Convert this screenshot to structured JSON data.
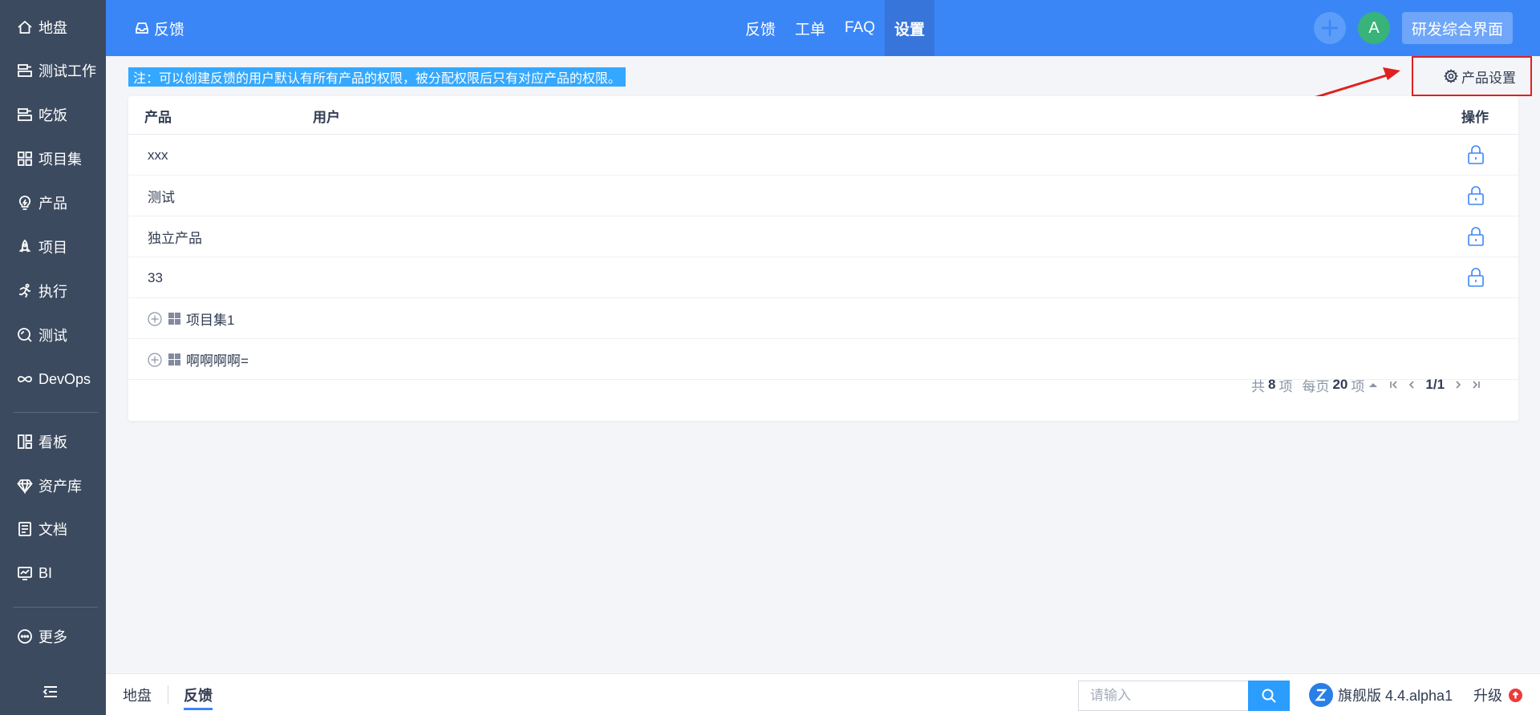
{
  "sidebar": {
    "items": [
      {
        "label": "地盘",
        "icon": "home-icon"
      },
      {
        "label": "测试工作",
        "icon": "workspace-icon"
      },
      {
        "label": "吃饭",
        "icon": "workspace-icon"
      },
      {
        "label": "项目集",
        "icon": "grid-icon"
      },
      {
        "label": "产品",
        "icon": "lightbulb-icon"
      },
      {
        "label": "项目",
        "icon": "rocket-icon"
      },
      {
        "label": "执行",
        "icon": "run-icon"
      },
      {
        "label": "测试",
        "icon": "magnify-icon"
      },
      {
        "label": "DevOps",
        "icon": "infinity-icon"
      },
      {
        "label": "看板",
        "icon": "kanban-icon"
      },
      {
        "label": "资产库",
        "icon": "diamond-icon"
      },
      {
        "label": "文档",
        "icon": "document-icon"
      },
      {
        "label": "BI",
        "icon": "monitor-chart-icon"
      },
      {
        "label": "更多",
        "icon": "more-icon"
      }
    ]
  },
  "header": {
    "title": "反馈",
    "tabs": [
      {
        "label": "反馈",
        "active": false
      },
      {
        "label": "工单",
        "active": false
      },
      {
        "label": "FAQ",
        "active": false
      },
      {
        "label": "设置",
        "active": true
      }
    ],
    "avatar_letter": "A",
    "space_label": "研发综合界面"
  },
  "notice": "注：可以创建反馈的用户默认有所有产品的权限，被分配权限后只有对应产品的权限。",
  "product_settings_label": "产品设置",
  "table": {
    "columns": {
      "product": "产品",
      "user": "用户",
      "action": "操作"
    },
    "products": [
      {
        "name": "xxx"
      },
      {
        "name": "测试"
      },
      {
        "name": "独立产品"
      },
      {
        "name": "33"
      }
    ],
    "groups": [
      {
        "name": "项目集1"
      },
      {
        "name": "啊啊啊啊="
      }
    ]
  },
  "pager": {
    "total_prefix": "共",
    "total": "8",
    "total_suffix": "项",
    "per_page_prefix": "每页",
    "per_page": "20",
    "per_page_suffix": "项",
    "page": "1/1"
  },
  "footer": {
    "crumbs": [
      "地盘",
      "反馈"
    ],
    "search_placeholder": "请输入",
    "version": "旗舰版 4.4.alpha1",
    "upgrade": "升级"
  },
  "colors": {
    "header": "#3b86f7",
    "sidebar": "#3c4a5f",
    "notice": "#34a8ff",
    "annotation": "#e02020"
  }
}
